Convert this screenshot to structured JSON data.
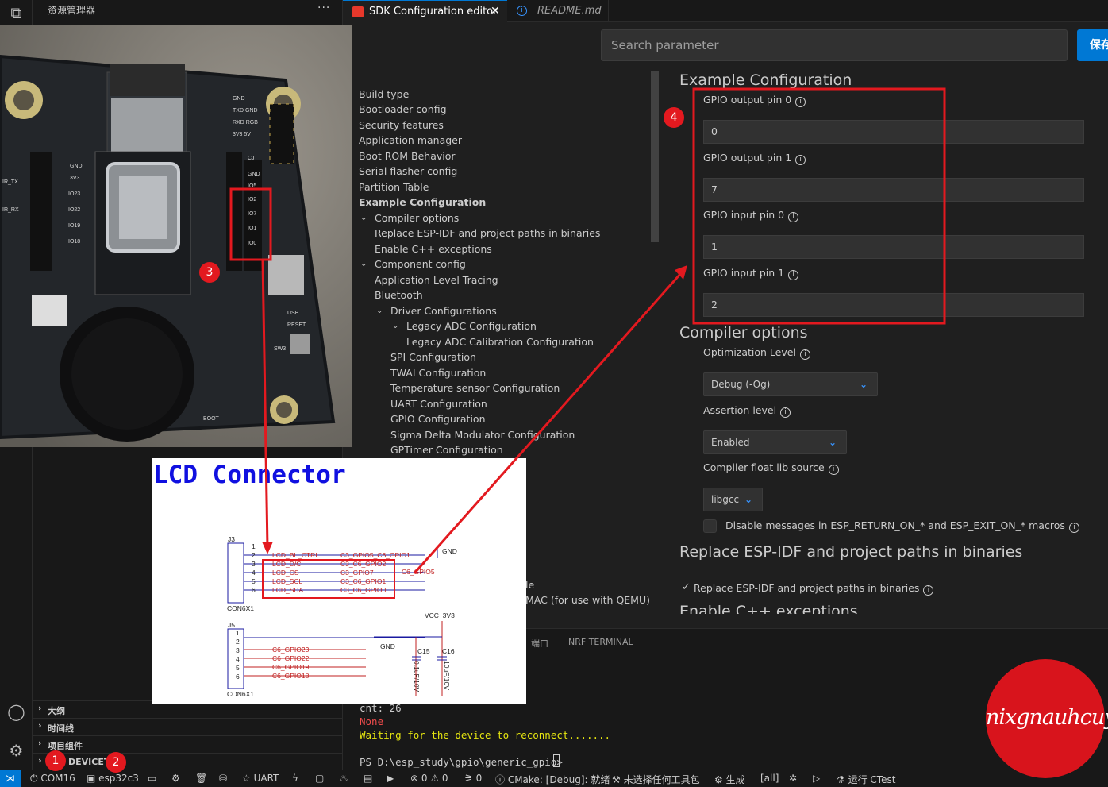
{
  "sidebar": {
    "title": "资源管理器",
    "more": "···",
    "sections": [
      {
        "label": "大纲"
      },
      {
        "label": "时间线"
      },
      {
        "label": "项目组件"
      },
      {
        "label": "DEVICETR"
      }
    ]
  },
  "tabs": [
    {
      "label": "SDK Configuration editor",
      "close": "✕"
    },
    {
      "label": "README.md",
      "icon": "ⓘ"
    }
  ],
  "editor": {
    "search_placeholder": "Search parameter",
    "save_label": "保存",
    "tree": [
      "Build type",
      "Bootloader config",
      "Security features",
      "Application manager",
      "Boot ROM Behavior",
      "Serial flasher config",
      "Partition Table",
      "Example Configuration",
      "Compiler options",
      "Replace ESP-IDF and project paths in binaries",
      "Enable C++ exceptions",
      "Component config",
      "Application Level Tracing",
      "Bluetooth",
      "Driver Configurations",
      "Legacy ADC Configuration",
      "Legacy ADC Calibration Configuration",
      "SPI Configuration",
      "TWAI Configuration",
      "Temperature sensor Configuration",
      "UART Configuration",
      "GPIO Configuration",
      "Sigma Delta Modulator Configuration",
      "GPTimer Configuration"
    ],
    "tree_partial": [
      "le",
      "MAC (for use with QEMU)"
    ],
    "example": {
      "title": "Example Configuration",
      "fields": [
        {
          "label": "GPIO output pin 0",
          "value": "0"
        },
        {
          "label": "GPIO output pin 1",
          "value": "7"
        },
        {
          "label": "GPIO input pin 0",
          "value": "1"
        },
        {
          "label": "GPIO input pin 1",
          "value": "2"
        }
      ]
    },
    "compiler": {
      "title": "Compiler options",
      "opt_label": "Optimization Level",
      "opt_value": "Debug (-Og)",
      "assert_label": "Assertion level",
      "assert_value": "Enabled",
      "float_label": "Compiler float lib source",
      "float_value": "libgcc",
      "disable_msg_label": "Disable messages in ESP_RETURN_ON_* and ESP_EXIT_ON_* macros"
    },
    "replace": {
      "title": "Replace ESP-IDF and project paths in binaries",
      "check_label": "Replace ESP-IDF and project paths in binaries",
      "check_mark": "✓"
    },
    "cpp_title": "Enable C++ exceptions",
    "info_glyph": "i",
    "chevron": "⌄"
  },
  "panel": {
    "tabs": [
      "端口",
      "NRF TERMINAL"
    ],
    "lines": [
      {
        "text": "cnt: 26",
        "color": "#cccccc"
      },
      {
        "text": "None",
        "color": "#f14c4c"
      },
      {
        "text": "Waiting for the device to reconnect.......",
        "color": "#e5e510"
      },
      {
        "text": "PS D:\\esp_study\\gpio\\generic_gpio> ",
        "color": "#cccccc"
      }
    ]
  },
  "status": {
    "remote": "⋊",
    "com": "COM16",
    "target": "esp32c3",
    "uart": "UART",
    "problems": "⊗ 0 ⚠ 0",
    "ports": "⚞ 0",
    "cmake": "CMake: [Debug]: 就绪",
    "kit": "未选择任何工具包",
    "build": "生成",
    "all": "[all]",
    "ctest": "运行 CTest"
  },
  "badges": [
    "1",
    "2",
    "3",
    "4"
  ],
  "schematic": {
    "title": "LCD Connector",
    "j3": "J3",
    "j5": "J5",
    "con1": "CON6X1",
    "con2": "CON6X1",
    "pins": [
      "1",
      "2",
      "3",
      "4",
      "5",
      "6"
    ],
    "j3_signals": [
      "LCD_BL_CTRL",
      "LCD_D/C",
      "LCD_CS",
      "LCD_SCL",
      "LCD_SDA"
    ],
    "j3_gpios": [
      "C3_GPIO5_C6_GPIO1",
      "C3_C6_GPIO2",
      "C3_GPIO7",
      "C3_C6_GPIO1",
      "C3_C6_GPIO0"
    ],
    "j3_extra": "C6_GPIO5",
    "j5_gpios": [
      "C6_GPIO23",
      "C6_GPIO22",
      "C6_GPIO19",
      "C6_GPIO18"
    ],
    "gnd": "GND",
    "vcc": "VCC_3V3",
    "c15": "C15",
    "c16": "C16",
    "c15_val": "0.1uF/10V",
    "c16_val": "10uF/10V",
    "board_labels": [
      "GND",
      "TXD GND",
      "RXD RGB",
      "3V3 5V",
      "CJ",
      "GND",
      "IO5",
      "IO2",
      "IO7",
      "IO1",
      "IO0",
      "IO23",
      "IO22",
      "IO19",
      "IO18",
      "3V3",
      "GND",
      "IR_TX",
      "IR_RX",
      "RESET",
      "BOOT",
      "USB",
      "SW3"
    ]
  },
  "watermark": "nixgnauhcuy",
  "colors": {
    "accent": "#0078d4",
    "annotation": "#e3191f"
  }
}
